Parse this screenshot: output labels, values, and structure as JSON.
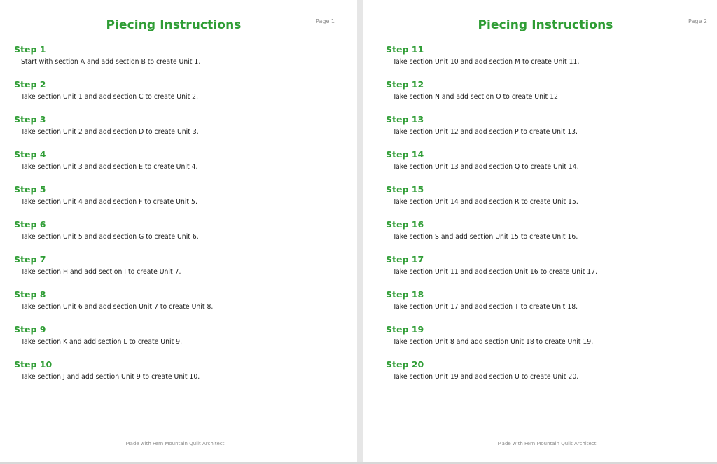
{
  "pages": [
    {
      "title": "Piecing Instructions",
      "page_label": "Page 1",
      "footer": "Made with Fern Mountain Quilt Architect",
      "steps": [
        {
          "title": "Step 1",
          "text": "Start with section A and add section B to create Unit 1."
        },
        {
          "title": "Step 2",
          "text": "Take section Unit 1 and add section C to create Unit 2."
        },
        {
          "title": "Step 3",
          "text": "Take section Unit 2 and add section D to create Unit 3."
        },
        {
          "title": "Step 4",
          "text": "Take section Unit 3 and add section E to create Unit 4."
        },
        {
          "title": "Step 5",
          "text": "Take section Unit 4 and add section F to create Unit 5."
        },
        {
          "title": "Step 6",
          "text": "Take section Unit 5 and add section G to create Unit 6."
        },
        {
          "title": "Step 7",
          "text": "Take section H and add section I to create Unit 7."
        },
        {
          "title": "Step 8",
          "text": "Take section Unit 6 and add section Unit 7 to create Unit 8."
        },
        {
          "title": "Step 9",
          "text": "Take section K and add section L to create Unit 9."
        },
        {
          "title": "Step 10",
          "text": "Take section J and add section Unit 9 to create Unit 10."
        }
      ]
    },
    {
      "title": "Piecing Instructions",
      "page_label": "Page 2",
      "footer": "Made with Fern Mountain Quilt Architect",
      "steps": [
        {
          "title": "Step 11",
          "text": "Take section Unit 10 and add section M to create Unit 11."
        },
        {
          "title": "Step 12",
          "text": "Take section N and add section O to create Unit 12."
        },
        {
          "title": "Step 13",
          "text": "Take section Unit 12 and add section P to create Unit 13."
        },
        {
          "title": "Step 14",
          "text": "Take section Unit 13 and add section Q to create Unit 14."
        },
        {
          "title": "Step 15",
          "text": "Take section Unit 14 and add section R to create Unit 15."
        },
        {
          "title": "Step 16",
          "text": "Take section S and add section Unit 15 to create Unit 16."
        },
        {
          "title": "Step 17",
          "text": "Take section Unit 11 and add section Unit 16 to create Unit 17."
        },
        {
          "title": "Step 18",
          "text": "Take section Unit 17 and add section T to create Unit 18."
        },
        {
          "title": "Step 19",
          "text": "Take section Unit 8 and add section Unit 18 to create Unit 19."
        },
        {
          "title": "Step 20",
          "text": "Take section Unit 19 and add section U to create Unit 20."
        }
      ]
    }
  ],
  "colors": {
    "heading": "#2f9d35",
    "body_text": "#1e1e1e",
    "muted_text": "#8a8a8a",
    "page_background": "#ffffff",
    "viewer_background": "#e6e6e6"
  }
}
